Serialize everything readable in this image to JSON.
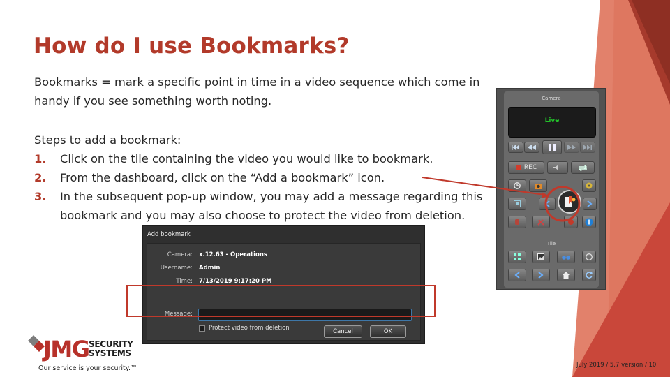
{
  "slide": {
    "title": "How do I use Bookmarks?",
    "intro": "Bookmarks = mark a specific point in time in a video sequence which come in handy if you see something worth noting.",
    "steps_heading": "Steps to add a bookmark:",
    "steps": [
      {
        "num": "1.",
        "text": "Click on the tile containing the video you would like to bookmark."
      },
      {
        "num": "2.",
        "text": "From the dashboard, click on the “Add a bookmark” icon."
      },
      {
        "num": "3.",
        "text": "In the subsequent pop-up window, you may add a message regarding this bookmark and you may also choose to protect the video from deletion."
      }
    ],
    "footer": "July 2019 / 5.7 version / 10"
  },
  "camera_panel": {
    "title": "Camera",
    "live_label": "Live",
    "rec_label": "REC",
    "tile_label": "Tile"
  },
  "dialog": {
    "title": "Add bookmark",
    "camera_label": "Camera:",
    "camera_value": "x.12.63 - Operations",
    "username_label": "Username:",
    "username_value": "Admin",
    "time_label": "Time:",
    "time_value": "7/13/2019 9:17:20 PM",
    "message_label": "Message:",
    "message_value": "",
    "protect_label": "Protect video from deletion",
    "protect_checked": false,
    "cancel_label": "Cancel",
    "ok_label": "OK"
  },
  "logo": {
    "brand_main": "JMG",
    "brand_line1": "SECURITY",
    "brand_line2": "SYSTEMS",
    "tagline": "Our service is your security.™"
  },
  "colors": {
    "accent": "#b23a2a",
    "deco_dark": "#a63a2c",
    "deco_light": "#e07a63",
    "callout": "#c0392b"
  }
}
